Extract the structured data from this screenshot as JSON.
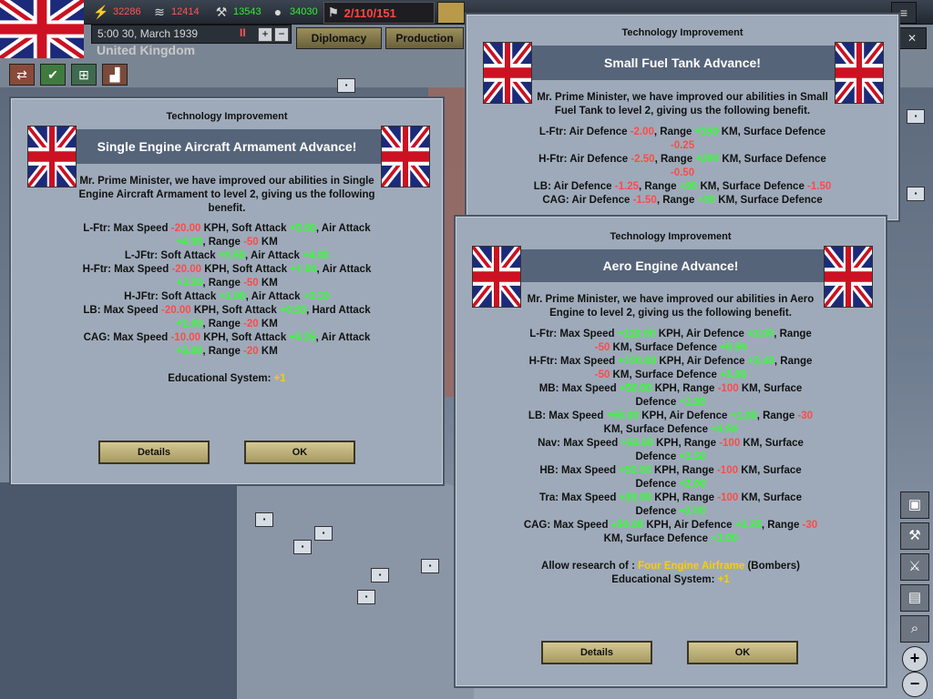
{
  "top_bar": {
    "resources": [
      {
        "icon": "energy-icon",
        "value": "32286",
        "color": "#ff5555"
      },
      {
        "icon": "metal-icon",
        "value": "12414",
        "color": "#ff5555"
      },
      {
        "icon": "rare-materials-icon",
        "value": "13543",
        "color": "#33ee33"
      },
      {
        "icon": "oil-icon",
        "value": "34030",
        "color": "#33ee33"
      }
    ],
    "manpower": "2/110/151",
    "date": "5:00 30, March 1939",
    "country": "United Kingdom",
    "pause_label": "II",
    "speed_up": "+",
    "speed_down": "−",
    "tabs": [
      "Diplomacy",
      "Production"
    ]
  },
  "dialog_armament": {
    "header": "Technology Improvement",
    "title": "Single Engine Aircraft Armament Advance!",
    "intro": [
      "Mr. Prime Minister, we have improved our abilities in Single",
      "Engine Aircraft Armament to level 2, giving us the following",
      "benefit."
    ],
    "lines": [
      [
        [
          "L-Ftr: Max Speed ",
          ""
        ],
        [
          "-20.00",
          "red"
        ],
        [
          " KPH, Soft Attack ",
          ""
        ],
        [
          "+0.50",
          "green"
        ],
        [
          ", Air Attack",
          ""
        ]
      ],
      [
        [
          "+4.00",
          "green"
        ],
        [
          ", Range ",
          ""
        ],
        [
          "-50",
          "red"
        ],
        [
          " KM",
          ""
        ]
      ],
      [
        [
          "L-JFtr: Soft Attack ",
          ""
        ],
        [
          "+0.50",
          "green"
        ],
        [
          ", Air Attack ",
          ""
        ],
        [
          "+4.00",
          "green"
        ]
      ],
      [
        [
          "H-Ftr: Max Speed ",
          ""
        ],
        [
          "-20.00",
          "red"
        ],
        [
          " KPH, Soft Attack ",
          ""
        ],
        [
          "+1.00",
          "green"
        ],
        [
          ", Air Attack",
          ""
        ]
      ],
      [
        [
          "+3.50",
          "green"
        ],
        [
          ", Range ",
          ""
        ],
        [
          "-50",
          "red"
        ],
        [
          " KM",
          ""
        ]
      ],
      [
        [
          "H-JFtr: Soft Attack ",
          ""
        ],
        [
          "+1.00",
          "green"
        ],
        [
          ", Air Attack ",
          ""
        ],
        [
          "+3.50",
          "green"
        ]
      ],
      [
        [
          "LB: Max Speed ",
          ""
        ],
        [
          "-20.00",
          "red"
        ],
        [
          " KPH, Soft Attack ",
          ""
        ],
        [
          "+0.50",
          "green"
        ],
        [
          ", Hard Attack",
          ""
        ]
      ],
      [
        [
          "+1.00",
          "green"
        ],
        [
          ", Range ",
          ""
        ],
        [
          "-20",
          "red"
        ],
        [
          " KM",
          ""
        ]
      ],
      [
        [
          "CAG: Max Speed ",
          ""
        ],
        [
          "-10.00",
          "red"
        ],
        [
          " KPH, Soft Attack ",
          ""
        ],
        [
          "+0.25",
          "green"
        ],
        [
          ", Air Attack",
          ""
        ]
      ],
      [
        [
          "+3.00",
          "green"
        ],
        [
          ", Range ",
          ""
        ],
        [
          "-20",
          "red"
        ],
        [
          " KM",
          ""
        ]
      ],
      [
        [
          "",
          ""
        ]
      ],
      [
        [
          "Educational System: ",
          ""
        ],
        [
          "+1",
          "yellow"
        ]
      ]
    ],
    "details_label": "Details",
    "ok_label": "OK"
  },
  "dialog_fuel": {
    "header": "Technology Improvement",
    "title": "Small Fuel Tank Advance!",
    "intro": [
      "Mr. Prime Minister, we have improved our abilities in Small",
      "Fuel Tank to level 2, giving us the following benefit."
    ],
    "lines": [
      [
        [
          "L-Ftr: Air Defence ",
          ""
        ],
        [
          "-2.00",
          "red"
        ],
        [
          ", Range ",
          ""
        ],
        [
          "+150",
          "green"
        ],
        [
          " KM, Surface Defence",
          ""
        ]
      ],
      [
        [
          "-0.25",
          "red"
        ]
      ],
      [
        [
          "H-Ftr: Air Defence ",
          ""
        ],
        [
          "-2.50",
          "red"
        ],
        [
          ", Range ",
          ""
        ],
        [
          "+200",
          "green"
        ],
        [
          " KM, Surface Defence",
          ""
        ]
      ],
      [
        [
          "-0.50",
          "red"
        ]
      ],
      [
        [
          "LB: Air Defence ",
          ""
        ],
        [
          "-1.25",
          "red"
        ],
        [
          ", Range ",
          ""
        ],
        [
          "+90",
          "green"
        ],
        [
          " KM, Surface Defence ",
          ""
        ],
        [
          "-1.50",
          "red"
        ]
      ],
      [
        [
          "CAG: Air Defence ",
          ""
        ],
        [
          "-1.50",
          "red"
        ],
        [
          ", Range ",
          ""
        ],
        [
          "+90",
          "green"
        ],
        [
          " KM, Surface Defence",
          ""
        ]
      ]
    ]
  },
  "dialog_aero": {
    "header": "Technology Improvement",
    "title": "Aero Engine Advance!",
    "intro": [
      "Mr. Prime Minister, we have improved our abilities in Aero",
      "Engine to level 2, giving us the following benefit."
    ],
    "lines": [
      [
        [
          "L-Ftr: Max Speed ",
          ""
        ],
        [
          "+120.00",
          "green"
        ],
        [
          " KPH, Air Defence ",
          ""
        ],
        [
          "+3.00",
          "green"
        ],
        [
          ", Range",
          ""
        ]
      ],
      [
        [
          "-50",
          "red"
        ],
        [
          " KM, Surface Defence ",
          ""
        ],
        [
          "+0.50",
          "green"
        ]
      ],
      [
        [
          "H-Ftr: Max Speed ",
          ""
        ],
        [
          "+100.00",
          "green"
        ],
        [
          " KPH, Air Defence ",
          ""
        ],
        [
          "+3.40",
          "green"
        ],
        [
          ", Range",
          ""
        ]
      ],
      [
        [
          "-50",
          "red"
        ],
        [
          " KM, Surface Defence ",
          ""
        ],
        [
          "+1.00",
          "green"
        ]
      ],
      [
        [
          "MB: Max Speed ",
          ""
        ],
        [
          "+50.00",
          "green"
        ],
        [
          " KPH, Range ",
          ""
        ],
        [
          "-100",
          "red"
        ],
        [
          " KM, Surface",
          ""
        ]
      ],
      [
        [
          "Defence ",
          ""
        ],
        [
          "+1.50",
          "green"
        ]
      ],
      [
        [
          "LB: Max Speed ",
          ""
        ],
        [
          "+50.00",
          "green"
        ],
        [
          " KPH, Air Defence ",
          ""
        ],
        [
          "+1.00",
          "green"
        ],
        [
          ", Range ",
          ""
        ],
        [
          "-30",
          "red"
        ]
      ],
      [
        [
          "KM, Surface Defence ",
          ""
        ],
        [
          "+0.50",
          "green"
        ]
      ],
      [
        [
          "Nav: Max Speed ",
          ""
        ],
        [
          "+50.00",
          "green"
        ],
        [
          " KPH, Range ",
          ""
        ],
        [
          "-100",
          "red"
        ],
        [
          " KM, Surface",
          ""
        ]
      ],
      [
        [
          "Defence ",
          ""
        ],
        [
          "+1.50",
          "green"
        ]
      ],
      [
        [
          "HB: Max Speed ",
          ""
        ],
        [
          "+50.00",
          "green"
        ],
        [
          " KPH, Range ",
          ""
        ],
        [
          "-100",
          "red"
        ],
        [
          " KM, Surface",
          ""
        ]
      ],
      [
        [
          "Defence ",
          ""
        ],
        [
          "+2.00",
          "green"
        ]
      ],
      [
        [
          "Tra: Max Speed ",
          ""
        ],
        [
          "+30.00",
          "green"
        ],
        [
          " KPH, Range ",
          ""
        ],
        [
          "-100",
          "red"
        ],
        [
          " KM, Surface",
          ""
        ]
      ],
      [
        [
          "Defence ",
          ""
        ],
        [
          "+2.00",
          "green"
        ]
      ],
      [
        [
          "CAG: Max Speed ",
          ""
        ],
        [
          "+50.00",
          "green"
        ],
        [
          " KPH, Air Defence ",
          ""
        ],
        [
          "+2.25",
          "green"
        ],
        [
          ", Range ",
          ""
        ],
        [
          "-30",
          "red"
        ]
      ],
      [
        [
          "KM, Surface Defence ",
          ""
        ],
        [
          "+3.00",
          "green"
        ]
      ],
      [
        [
          "",
          ""
        ]
      ],
      [
        [
          "Allow research of : ",
          ""
        ],
        [
          "Four Engine Airframe",
          "yellow"
        ],
        [
          " (Bombers)",
          ""
        ]
      ],
      [
        [
          "Educational System: ",
          ""
        ],
        [
          "+1",
          "yellow"
        ]
      ]
    ],
    "details_label": "Details",
    "ok_label": "OK"
  },
  "colors": {
    "red": "#ff4a4a",
    "green": "#33ff33",
    "yellow": "#ffcc00"
  }
}
